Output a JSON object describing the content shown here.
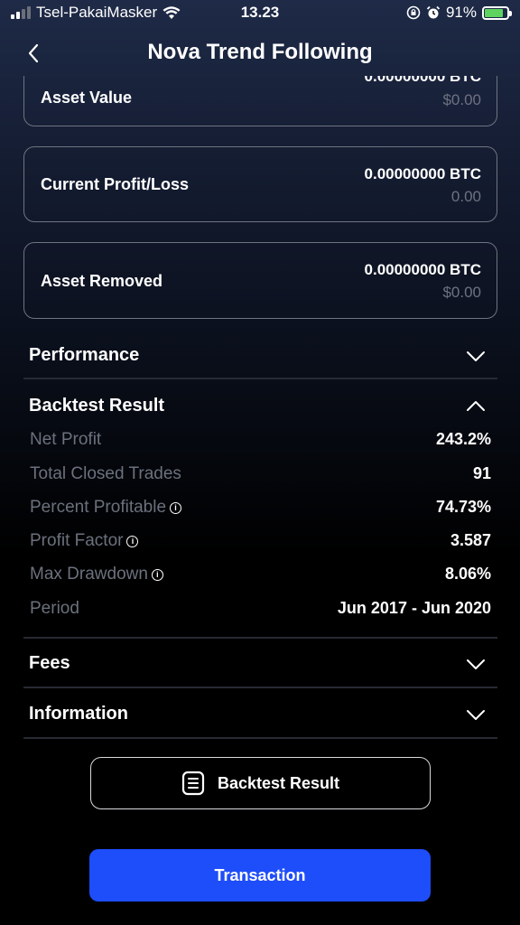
{
  "status_bar": {
    "carrier": "Tsel-PakaiMasker",
    "time": "13.23",
    "battery": "91%",
    "icons": [
      "signal-icon",
      "wifi-icon",
      "rotation-lock-icon",
      "alarm-icon",
      "battery-icon"
    ]
  },
  "nav": {
    "back_icon": "chevron-left-icon",
    "title": "Nova Trend Following"
  },
  "cards": [
    {
      "label": "Asset Value",
      "amount": "0.00000000 BTC",
      "fiat": "$0.00"
    },
    {
      "label": "Current Profit/Loss",
      "amount": "0.00000000 BTC",
      "fiat": "0.00"
    },
    {
      "label": "Asset Removed",
      "amount": "0.00000000 BTC",
      "fiat": "$0.00"
    }
  ],
  "sections": {
    "performance": {
      "title": "Performance",
      "expanded": false
    },
    "backtest": {
      "title": "Backtest Result",
      "expanded": true,
      "rows": [
        {
          "label": "Net Profit",
          "value": "243.2%",
          "info": false
        },
        {
          "label": "Total Closed Trades",
          "value": "91",
          "info": false
        },
        {
          "label": "Percent Profitable",
          "value": "74.73%",
          "info": true
        },
        {
          "label": "Profit Factor",
          "value": "3.587",
          "info": true
        },
        {
          "label": "Max Drawdown",
          "value": "8.06%",
          "info": true
        },
        {
          "label": "Period",
          "value": "Jun 2017 - Jun 2020",
          "info": false
        }
      ]
    },
    "fees": {
      "title": "Fees",
      "expanded": false
    },
    "information": {
      "title": "Information",
      "expanded": false
    }
  },
  "buttons": {
    "backtest_result": "Backtest Result",
    "transaction": "Transaction"
  },
  "colors": {
    "primary": "#1e4dfa",
    "muted_text": "#6b717d",
    "battery_fill": "#5fd35f"
  }
}
